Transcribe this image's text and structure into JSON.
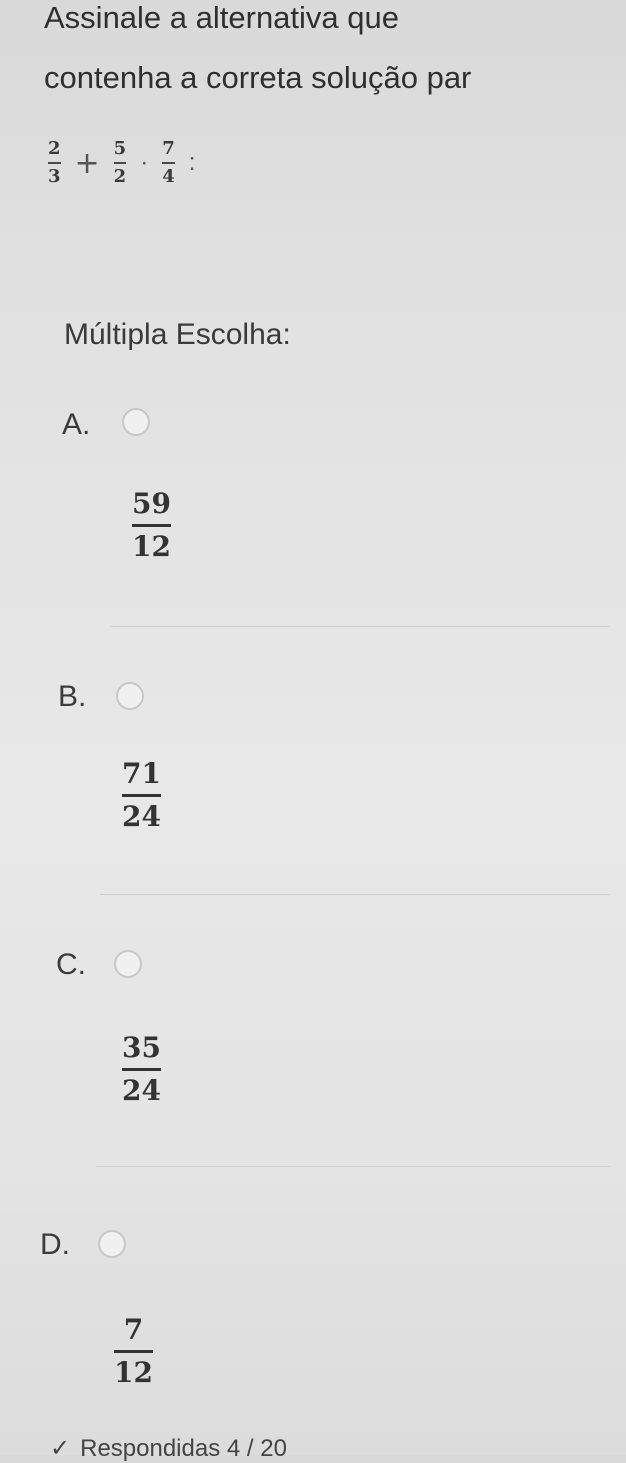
{
  "question": {
    "line1": "Assinale a alternativa que",
    "line2": "contenha a correta solução par",
    "expression": {
      "frac1": {
        "num": "2",
        "den": "3"
      },
      "op1": "+",
      "frac2": {
        "num": "5",
        "den": "2"
      },
      "op2": "·",
      "frac3": {
        "num": "7",
        "den": "4"
      },
      "end": ":"
    }
  },
  "section_title": "Múltipla Escolha:",
  "options": [
    {
      "letter": "A.",
      "num": "59",
      "den": "12"
    },
    {
      "letter": "B.",
      "num": "71",
      "den": "24"
    },
    {
      "letter": "C.",
      "num": "35",
      "den": "24"
    },
    {
      "letter": "D.",
      "num": "7",
      "den": "12"
    }
  ],
  "footer": {
    "check_icon": "check-icon",
    "text": "Respondidas 4 / 20"
  }
}
